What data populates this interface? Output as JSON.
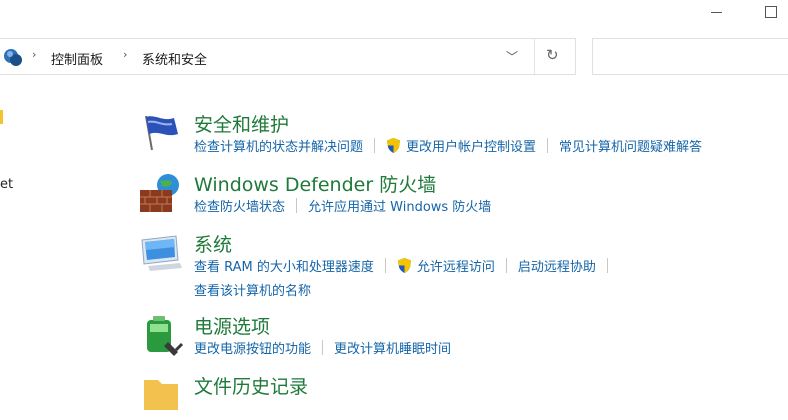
{
  "window": {
    "minimize_icon": "minimize-icon",
    "maximize_icon": "maximize-icon"
  },
  "address": {
    "crumbs": [
      "控制面板",
      "系统和安全"
    ],
    "refresh_icon": "refresh-icon",
    "dropdown_icon": "chevron-down-icon"
  },
  "sidebar": {
    "partial_text": "et"
  },
  "categories": [
    {
      "title": "安全和维护",
      "icon": "security-flag-icon",
      "links": [
        {
          "label": "检查计算机的状态并解决问题",
          "shield": false
        },
        {
          "label": "更改用户帐户控制设置",
          "shield": true
        },
        {
          "label": "常见计算机问题疑难解答",
          "shield": false
        }
      ]
    },
    {
      "title": "Windows Defender 防火墙",
      "icon": "firewall-icon",
      "links": [
        {
          "label": "检查防火墙状态",
          "shield": false
        },
        {
          "label": "允许应用通过 Windows 防火墙",
          "shield": false
        }
      ]
    },
    {
      "title": "系统",
      "icon": "computer-icon",
      "links": [
        {
          "label": "查看 RAM 的大小和处理器速度",
          "shield": false
        },
        {
          "label": "允许远程访问",
          "shield": true
        },
        {
          "label": "启动远程协助",
          "shield": false
        }
      ],
      "links2": [
        {
          "label": "查看该计算机的名称",
          "shield": false
        }
      ]
    },
    {
      "title": "电源选项",
      "icon": "power-battery-icon",
      "links": [
        {
          "label": "更改电源按钮的功能",
          "shield": false
        },
        {
          "label": "更改计算机睡眠时间",
          "shield": false
        }
      ]
    },
    {
      "title": "文件历史记录",
      "icon": "folder-icon",
      "links": []
    }
  ],
  "colors": {
    "title_green": "#1f7a3a",
    "link_blue": "#1565a8"
  }
}
